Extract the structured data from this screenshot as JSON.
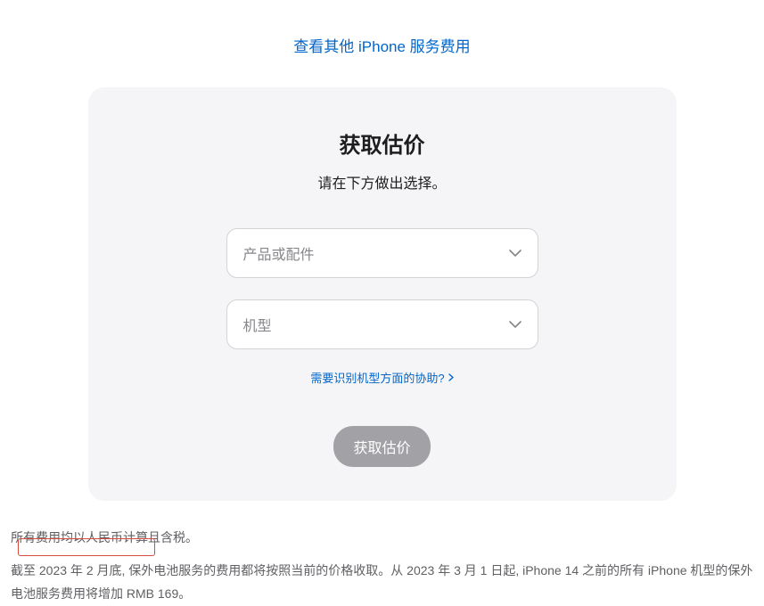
{
  "topLink": {
    "text": "查看其他 iPhone 服务费用"
  },
  "card": {
    "title": "获取估价",
    "subtitle": "请在下方做出选择。",
    "select1": {
      "placeholder": "产品或配件"
    },
    "select2": {
      "placeholder": "机型"
    },
    "helpLink": "需要识别机型方面的协助?",
    "button": "获取估价"
  },
  "footer": {
    "line1": "所有费用均以人民币计算且含税。",
    "line2": "截至 2023 年 2 月底, 保外电池服务的费用都将按照当前的价格收取。从 2023 年 3 月 1 日起, iPhone 14 之前的所有 iPhone 机型的保外电池服务费用将增加 RMB 169。"
  }
}
